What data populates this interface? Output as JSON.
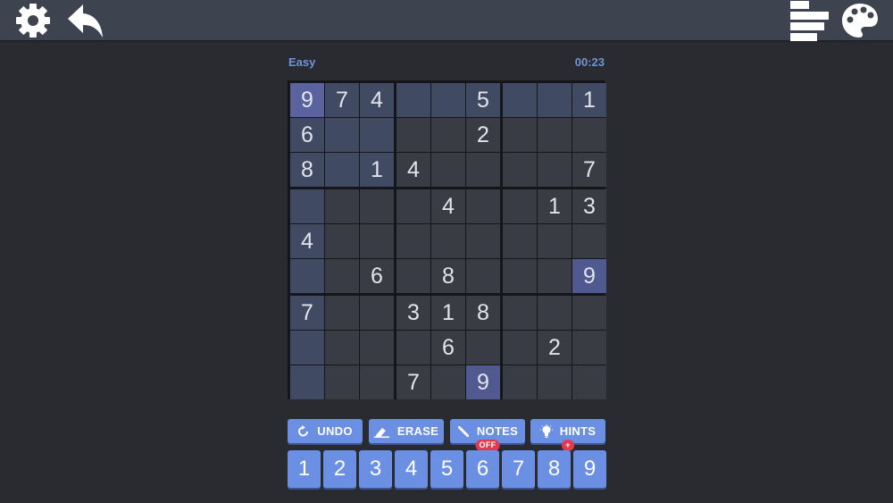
{
  "header": {
    "settings_icon": "gear-icon",
    "back_icon": "undo-arrow-icon",
    "stats_icon": "stats-bars-icon",
    "theme_icon": "palette-icon"
  },
  "game": {
    "difficulty": "Easy",
    "timer": "00:23"
  },
  "colors": {
    "cell_default": "#393c45",
    "cell_highlight": "#414a63",
    "cell_selected": "#5b639e",
    "cell_same_number": "#505a90",
    "accent": "#6b8fe2",
    "badge": "#e23a4e"
  },
  "board": {
    "selected": [
      0,
      0
    ],
    "grid": [
      [
        "9",
        "7",
        "4",
        "",
        "",
        "5",
        "",
        "",
        "1"
      ],
      [
        "6",
        "",
        "",
        "",
        "",
        "2",
        "",
        "",
        ""
      ],
      [
        "8",
        "",
        "1",
        "4",
        "",
        "",
        "",
        "",
        "7"
      ],
      [
        "",
        "",
        "",
        "",
        "4",
        "",
        "",
        "1",
        "3"
      ],
      [
        "4",
        "",
        "",
        "",
        "",
        "",
        "",
        "",
        ""
      ],
      [
        "",
        "",
        "6",
        "",
        "8",
        "",
        "",
        "",
        "9"
      ],
      [
        "7",
        "",
        "",
        "3",
        "1",
        "8",
        "",
        "",
        ""
      ],
      [
        "",
        "",
        "",
        "",
        "6",
        "",
        "",
        "2",
        ""
      ],
      [
        "",
        "",
        "",
        "7",
        "",
        "9",
        "",
        "",
        ""
      ]
    ]
  },
  "actions": [
    {
      "label": "UNDO",
      "icon": "undo-icon",
      "badge": ""
    },
    {
      "label": "ERASE",
      "icon": "eraser-icon",
      "badge": ""
    },
    {
      "label": "NOTES",
      "icon": "pencil-icon",
      "badge": "OFF"
    },
    {
      "label": "HINTS",
      "icon": "lightbulb-icon",
      "badge": "+"
    }
  ],
  "numpad": [
    "1",
    "2",
    "3",
    "4",
    "5",
    "6",
    "7",
    "8",
    "9"
  ]
}
